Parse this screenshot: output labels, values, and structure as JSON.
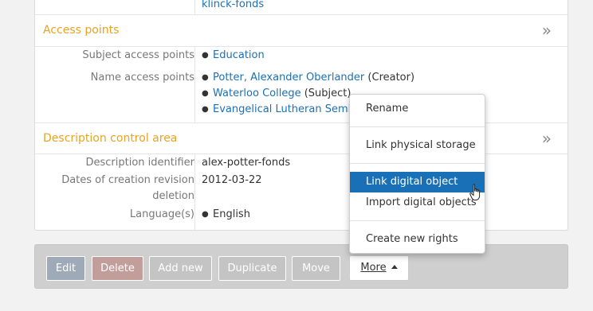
{
  "top_row": {
    "value": "klinck-fonds"
  },
  "access_points": {
    "title": "Access points",
    "subject_label": "Subject access points",
    "subject_items": [
      "Education"
    ],
    "name_label": "Name access points",
    "name_items": [
      {
        "link": "Potter, Alexander Oberlander",
        "role": " (Creator)"
      },
      {
        "link": "Waterloo College",
        "role": " (Subject)"
      },
      {
        "link": "Evangelical Lutheran Semin",
        "role": ""
      }
    ]
  },
  "description_control": {
    "title": "Description control area",
    "identifier_label": "Description identifier",
    "identifier_value": "alex-potter-fonds",
    "dates_label_1": "Dates of creation revision",
    "dates_label_2": "deletion",
    "dates_value": "2012-03-22",
    "language_label": "Language(s)",
    "language_value": "English"
  },
  "toolbar": {
    "edit": "Edit",
    "delete": "Delete",
    "add_new": "Add new",
    "duplicate": "Duplicate",
    "move": "Move",
    "more": "More"
  },
  "more_menu": {
    "rename": "Rename",
    "link_physical_storage": "Link physical storage",
    "link_digital_object": "Link digital object",
    "import_digital_objects": "Import digital objects",
    "create_new_rights": "Create new rights"
  },
  "icons": {
    "section_toggle": "double-chevron-right-icon",
    "more_caret": "caret-up-icon",
    "cursor": "hand-pointer-icon"
  },
  "colors": {
    "section_title": "#e8a323",
    "link": "#1a70b6",
    "edit_button": "#9faab9",
    "delete_button": "#c29e9b",
    "menu_active": "#1a70b6"
  }
}
